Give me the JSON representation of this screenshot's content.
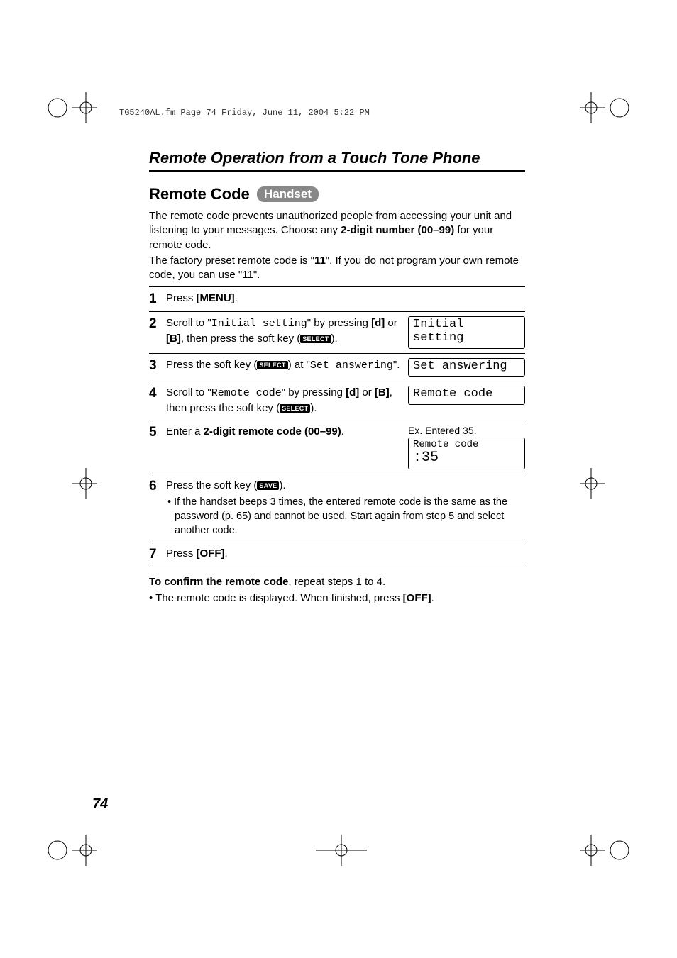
{
  "running_head": "TG5240AL.fm  Page 74  Friday, June 11, 2004  5:22 PM",
  "section_title": "Remote Operation from a Touch Tone Phone",
  "sub_title_prefix": "Remote Code",
  "sub_title_badge": "Handset",
  "intro": {
    "p1a": "The remote code prevents unauthorized people from accessing your unit and listening to your messages. Choose any ",
    "p1b": "2-digit number (00–99)",
    "p1c": " for your remote code.",
    "p2a": "The factory preset remote code is \"",
    "p2b": "11",
    "p2c": "\". If you do not program your own remote code, you can use \"11\"."
  },
  "steps": {
    "s1": {
      "num": "1",
      "a": "Press ",
      "b": "[MENU]",
      "c": "."
    },
    "s2": {
      "num": "2",
      "a": "Scroll to \"",
      "mono": "Initial setting",
      "b": "\" by pressing ",
      "down": "[d]",
      "c": " or ",
      "up": "[B]",
      "d": ", then press the soft key (",
      "chip": "SELECT",
      "e": ").",
      "lcd": "Initial setting"
    },
    "s3": {
      "num": "3",
      "a": "Press the soft key (",
      "chip": "SELECT",
      "b": ") at \"",
      "mono": "Set answering",
      "c": "\".",
      "lcd": "Set answering"
    },
    "s4": {
      "num": "4",
      "a": "Scroll to \"",
      "mono": "Remote code",
      "b": "\" by pressing ",
      "down": "[d]",
      "c": " or ",
      "up": "[B]",
      "d": ", then press the soft key (",
      "chip": "SELECT",
      "e": ").",
      "lcd": "Remote code"
    },
    "s5": {
      "num": "5",
      "a": "Enter a ",
      "b": "2-digit remote code (00–99)",
      "c": ".",
      "ex": "Ex. Entered 35.",
      "lcd1": "Remote code",
      "lcd2": ":35"
    },
    "s6": {
      "num": "6",
      "a": "Press the soft key (",
      "chip": " SAVE ",
      "b": ").",
      "bullet": "• If the handset beeps 3 times, the entered remote code is the same as the password (p. 65) and cannot be used. Start again from step 5 and select another code."
    },
    "s7": {
      "num": "7",
      "a": "Press ",
      "b": "[OFF]",
      "c": "."
    }
  },
  "after": {
    "line1a": "To confirm the remote code",
    "line1b": ", repeat steps 1 to 4.",
    "line2a": "• The remote code is displayed. When finished, press ",
    "line2b": "[OFF]",
    "line2c": "."
  },
  "page_number": "74"
}
